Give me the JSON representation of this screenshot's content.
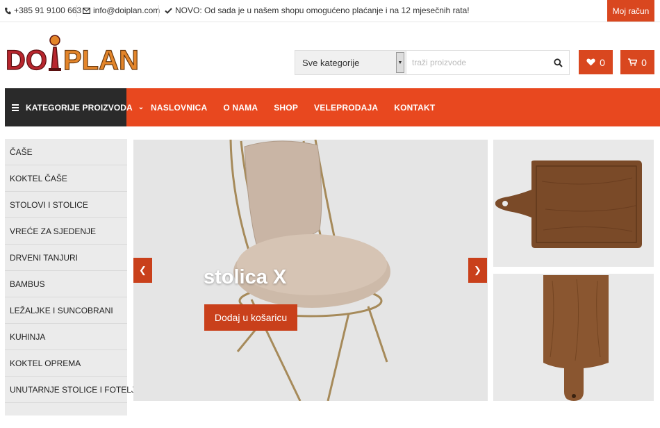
{
  "topbar": {
    "phone": "+385 91 9100 663",
    "email": "info@doiplan.com",
    "notice": "NOVO: Od sada je u našem shopu omogućeno plaćanje i na 12 mjesečnih rata!",
    "account_label": "Moj račun"
  },
  "logo": {
    "text": "DOIPLAN"
  },
  "search": {
    "category_selected": "Sve kategorije",
    "placeholder": "traži proizvode"
  },
  "header_buttons": {
    "wishlist_count": "0",
    "cart_count": "0"
  },
  "nav": {
    "categories_toggle": "KATEGORIJE PROIZVODA",
    "links": [
      "NASLOVNICA",
      "O NAMA",
      "SHOP",
      "VELEPRODAJA",
      "KONTAKT"
    ]
  },
  "sidebar": {
    "items": [
      "ČAŠE",
      "KOKTEL ČAŠE",
      "STOLOVI I STOLICE",
      "VREĆE ZA SJEDENJE",
      "DRVENI TANJURI",
      "BAMBUS",
      "LEŽALJKE I SUNCOBRANI",
      "KUHINJA",
      "KOKTEL OPREMA",
      "UNUTARNJE STOLICE I FOTELJE"
    ]
  },
  "slider": {
    "title": "stolica X",
    "cta_label": "Dodaj u košaricu",
    "prev_icon": "chevron-left-icon",
    "next_icon": "chevron-right-icon"
  },
  "colors": {
    "accent": "#e8481f",
    "accent_dark": "#c9401b",
    "nav_dark": "#2a2a2a",
    "sidebar_bg": "#ebebeb"
  },
  "icons": {
    "phone": "phone-icon",
    "email": "envelope-icon",
    "notice": "check-icon",
    "search": "search-icon",
    "wishlist": "heart-icon",
    "cart": "cart-icon"
  }
}
